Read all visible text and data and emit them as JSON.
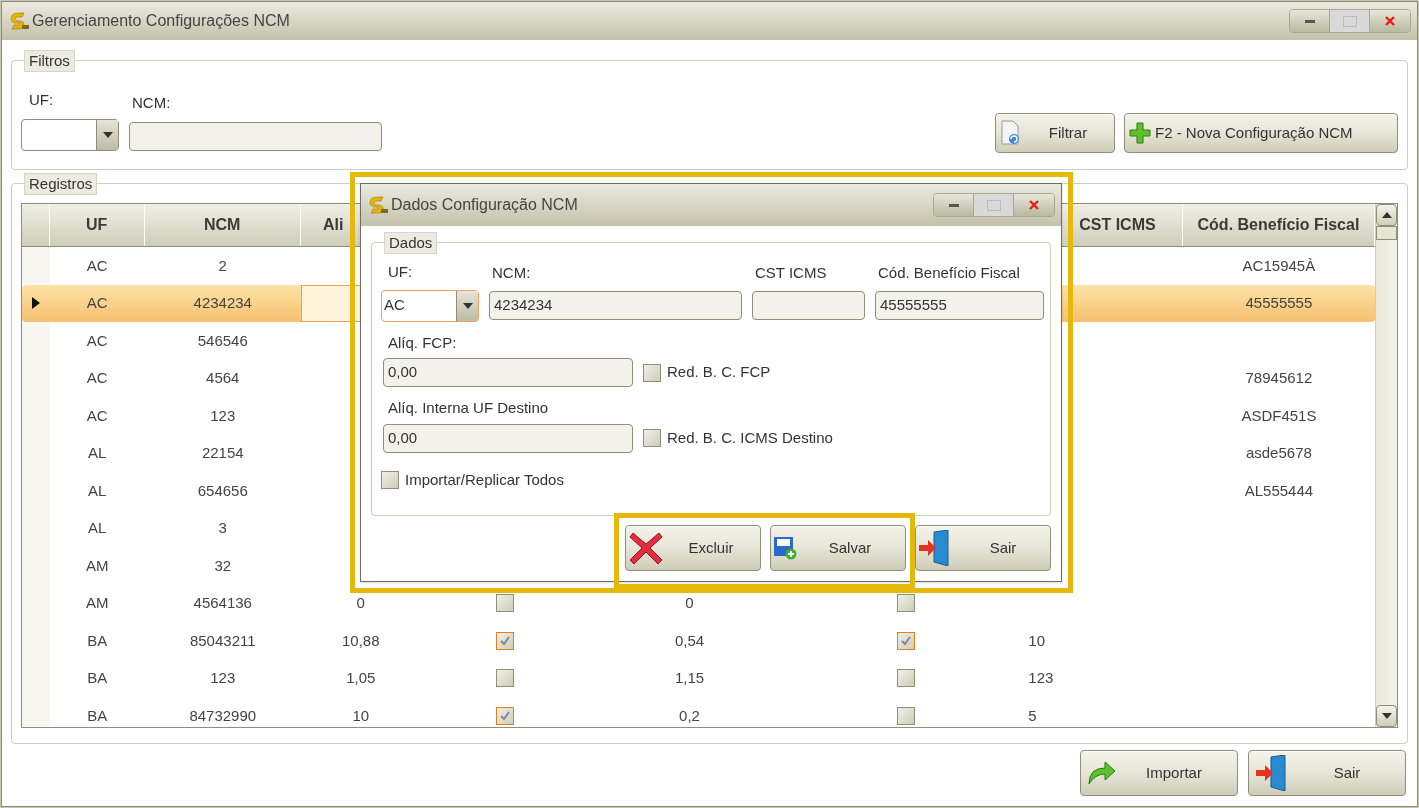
{
  "window": {
    "title": "Gerenciamento Configurações NCM"
  },
  "filters": {
    "legend": "Filtros",
    "uf_label": "UF:",
    "ncm_label": "NCM:",
    "buttons": [
      {
        "label": "Filtrar",
        "kind": "filter"
      },
      {
        "label": "F2 - Nova Configuração NCM",
        "kind": "add"
      }
    ]
  },
  "records": {
    "legend": "Registros",
    "header": {
      "uf": "UF",
      "ncm": "NCM",
      "column_3": "Ali",
      "cst_icms": "CST ICMS",
      "cod_beneficio_fiscal": "Cód. Benefício Fiscal"
    },
    "rows": [
      {
        "selected": false,
        "uf": "AC",
        "ncm": "2",
        "cod_beneficio_fiscal": "AC15945À"
      },
      {
        "selected": true,
        "uf": "AC",
        "ncm": "4234234",
        "cod_beneficio_fiscal": "45555555"
      },
      {
        "selected": false,
        "uf": "AC",
        "ncm": "546546"
      },
      {
        "selected": false,
        "uf": "AC",
        "ncm": "4564",
        "cod_beneficio_fiscal": "78945612"
      },
      {
        "selected": false,
        "uf": "AC",
        "ncm": "123",
        "cod_beneficio_fiscal": "ASDF451S"
      },
      {
        "selected": false,
        "uf": "AL",
        "ncm": "22154",
        "cod_beneficio_fiscal": "asde5678"
      },
      {
        "selected": false,
        "uf": "AL",
        "ncm": "654656",
        "cod_beneficio_fiscal": "AL555444"
      },
      {
        "selected": false,
        "uf": "AL",
        "ncm": "3"
      },
      {
        "selected": false,
        "uf": "AM",
        "ncm": "32"
      },
      {
        "selected": false,
        "uf": "AM",
        "ncm": "4564136",
        "column_3": "0",
        "column_4": {
          "checked": false
        },
        "column_5": "0",
        "column_6": {
          "checked": false
        }
      },
      {
        "selected": false,
        "uf": "BA",
        "ncm": "85043211",
        "column_3": "10,88",
        "column_4": {
          "checked": true
        },
        "column_5": "0,54",
        "column_6": {
          "checked": true
        },
        "cst_icms": "10"
      },
      {
        "selected": false,
        "uf": "BA",
        "ncm": "123",
        "column_3": "1,05",
        "column_4": {
          "checked": false
        },
        "column_5": "1,15",
        "column_6": {
          "checked": false
        },
        "cst_icms": "123"
      },
      {
        "selected": false,
        "uf": "BA",
        "ncm": "84732990",
        "column_3": "10",
        "column_4": {
          "checked": true
        },
        "column_5": "0,2",
        "column_6": {
          "checked": false
        },
        "cst_icms": "5"
      }
    ]
  },
  "dialog": {
    "title": "Dados Configuração NCM",
    "legend": "Dados",
    "uf": {
      "label": "UF:",
      "value": "AC"
    },
    "ncm": {
      "label": "NCM:",
      "value": "4234234"
    },
    "cst_icms": {
      "label": "CST ICMS"
    },
    "cod_beneficio_fiscal": {
      "label": "Cód. Benefício Fiscal",
      "value": "45555555"
    },
    "aliq_fcp": {
      "label": "Alíq. FCP:",
      "value": "0,00"
    },
    "red_bc_fcp": {
      "label": "Red. B. C. FCP",
      "checked": false
    },
    "aliq_interna": {
      "label": "Alíq. Interna UF Destino",
      "value": "0,00"
    },
    "red_bc_icms": {
      "label": "Red. B. C. ICMS Destino",
      "checked": false
    },
    "importar": {
      "label": "Importar/Replicar Todos",
      "checked": false
    },
    "buttons": [
      {
        "label": "Excluir",
        "kind": "delete"
      },
      {
        "label": "Salvar",
        "kind": "save"
      },
      {
        "label": "Sair",
        "kind": "exit"
      }
    ]
  },
  "footer_buttons": [
    {
      "label": "Importar",
      "kind": "import"
    },
    {
      "label": "Sair",
      "kind": "exit"
    }
  ]
}
